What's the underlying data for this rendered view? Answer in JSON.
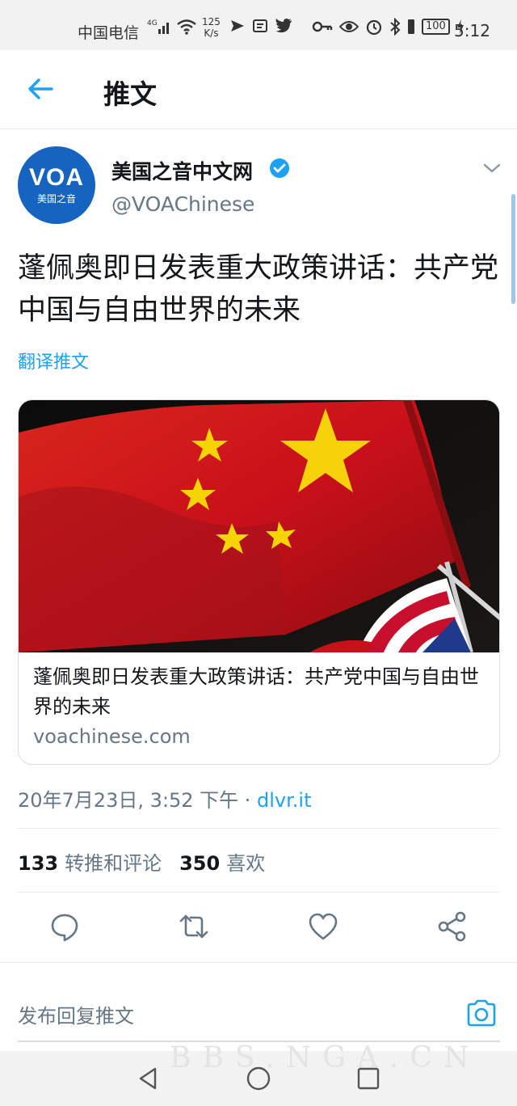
{
  "status_bar": {
    "carrier": "中国电信",
    "network": "4G",
    "speed_value": "125",
    "speed_unit": "K/s",
    "battery": "100",
    "time": "5:12"
  },
  "header": {
    "title": "推文"
  },
  "tweet": {
    "avatar_logo": "VOA",
    "avatar_sub": "美国之音",
    "display_name": "美国之音中文网",
    "handle": "@VOAChinese",
    "text": "蓬佩奥即日发表重大政策讲话：共产党中国与自由世界的未来",
    "translate_label": "翻译推文",
    "card": {
      "title": "蓬佩奥即日发表重大政策讲话：共产党中国与自由世界的未来",
      "domain": "voachinese.com"
    },
    "timestamp": "20年7月23日, 3:52 下午 · ",
    "source": "dlvr.it",
    "retweets_count": "133",
    "retweets_label": "转推和评论",
    "likes_count": "350",
    "likes_label": "喜欢"
  },
  "reply": {
    "placeholder": "发布回复推文"
  },
  "watermark": "BBS.NGA.CN",
  "colors": {
    "accent": "#1da1f2",
    "secondary_text": "#657786",
    "verified": "#1da1f2"
  },
  "icons": {
    "back": "arrow-left-icon",
    "verified": "verified-badge-icon",
    "caret": "chevron-down-icon",
    "reply": "comment-icon",
    "retweet": "retweet-icon",
    "like": "heart-icon",
    "share": "share-icon",
    "camera": "camera-icon"
  }
}
